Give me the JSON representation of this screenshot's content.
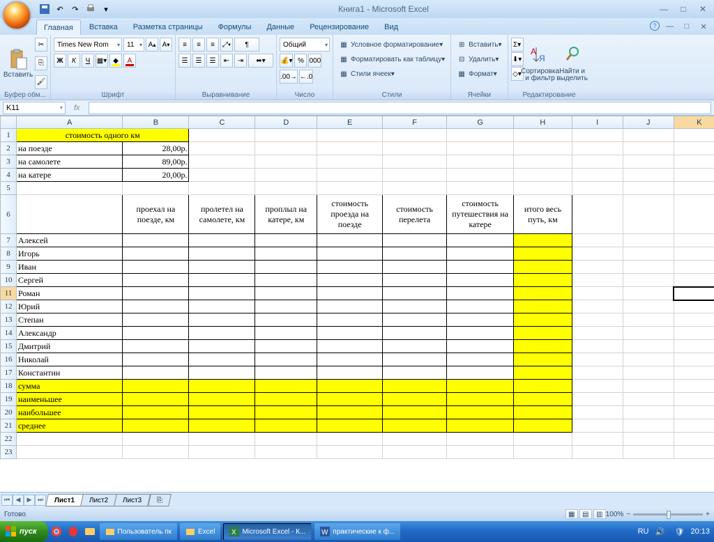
{
  "window": {
    "title": "Книга1 - Microsoft Excel"
  },
  "tabs": {
    "home": "Главная",
    "insert": "Вставка",
    "layout": "Разметка страницы",
    "formulas": "Формулы",
    "data": "Данные",
    "review": "Рецензирование",
    "view": "Вид"
  },
  "ribbon": {
    "clipboard": {
      "paste": "Вставить",
      "title": "Буфер обм..."
    },
    "font": {
      "name": "Times New Rom",
      "size": "11",
      "title": "Шрифт",
      "bold": "Ж",
      "italic": "К",
      "underline": "Ч"
    },
    "align": {
      "title": "Выравнивание"
    },
    "number": {
      "fmt": "Общий",
      "title": "Число"
    },
    "styles": {
      "cond": "Условное форматирование",
      "table": "Форматировать как таблицу",
      "cell": "Стили ячеек",
      "title": "Стили"
    },
    "cells": {
      "insert": "Вставить",
      "delete": "Удалить",
      "format": "Формат",
      "title": "Ячейки"
    },
    "edit": {
      "sort": "Сортировка и фильтр",
      "find": "Найти и выделить",
      "title": "Редактирование"
    }
  },
  "formula": {
    "cell": "K11"
  },
  "cols": [
    "A",
    "B",
    "C",
    "D",
    "E",
    "F",
    "G",
    "H",
    "I",
    "J",
    "K"
  ],
  "rows": [
    "1",
    "2",
    "3",
    "4",
    "5",
    "6",
    "7",
    "8",
    "9",
    "10",
    "11",
    "12",
    "13",
    "14",
    "15",
    "16",
    "17",
    "18",
    "19",
    "20",
    "21",
    "22",
    "23"
  ],
  "sheet": {
    "title": "стоимость одного км",
    "r2a": "на поезде",
    "r2b": "28,00р.",
    "r3a": "на самолете",
    "r3b": "89,00р.",
    "r4a": "на катере",
    "r4b": "20,00р.",
    "h_b": "проехал на поезде, км",
    "h_c": "пролетел на самолете, км",
    "h_d": "проплыл на катере, км",
    "h_e": "стоимость проезда на поезде",
    "h_f": "стоимость перелета",
    "h_g": "стоимость путешествия на катере",
    "h_h": "итого весь путь, км",
    "n7": "Алексей",
    "n8": "Игорь",
    "n9": "Иван",
    "n10": "Сергей",
    "n11": "Роман",
    "n12": "Юрий",
    "n13": "Степан",
    "n14": "Александр",
    "n15": "Дмитрий",
    "n16": "Николай",
    "n17": "Константин",
    "s18": "сумма",
    "s19": "наименьшее",
    "s20": "наибольшее",
    "s21": "среднее"
  },
  "sheets": {
    "s1": "Лист1",
    "s2": "Лист2",
    "s3": "Лист3"
  },
  "status": {
    "ready": "Готово",
    "zoom": "100%"
  },
  "taskbar": {
    "start": "пуск",
    "i1": "Пользователь пк",
    "i2": "Excel",
    "i3": "Microsoft Excel - К...",
    "i4": "практические к ф...",
    "lang": "RU",
    "time": "20:13"
  }
}
